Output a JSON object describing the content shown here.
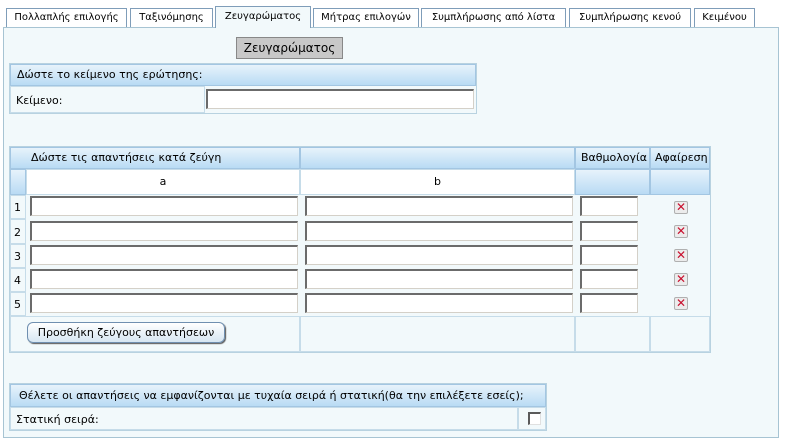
{
  "tabs": [
    {
      "label": "Πολλαπλής επιλογής"
    },
    {
      "label": "Ταξινόμησης"
    },
    {
      "label": "Ζευγαρώματος"
    },
    {
      "label": "Μήτρας επιλογών"
    },
    {
      "label": "Συμπλήρωσης από λίστα"
    },
    {
      "label": "Συμπλήρωσης κενού"
    },
    {
      "label": "Κειμένου"
    }
  ],
  "active_tab": "Ζευγαρώματος",
  "title_button": "Ζευγαρώματος",
  "question": {
    "header": "Δώστε το κείμενο της ερώτησης:",
    "label": "Κείμενο:",
    "value": ""
  },
  "pairs": {
    "header": "Δώστε τις απαντήσεις κατά ζεύγη",
    "col_a": "a",
    "col_b": "b",
    "col_score": "Βαθμολογία",
    "col_remove": "Αφαίρεση",
    "rows": [
      {
        "num": "1",
        "a": "",
        "b": "",
        "score": ""
      },
      {
        "num": "2",
        "a": "",
        "b": "",
        "score": ""
      },
      {
        "num": "3",
        "a": "",
        "b": "",
        "score": ""
      },
      {
        "num": "4",
        "a": "",
        "b": "",
        "score": ""
      },
      {
        "num": "5",
        "a": "",
        "b": "",
        "score": ""
      }
    ],
    "add_button": "Προσθήκη ζεύγους απαντήσεων",
    "remove_glyph": "✕"
  },
  "order": {
    "header": "Θέλετε οι απαντήσεις να εμφανίζονται με τυχαία σειρά ή στατική(θα την επιλέξετε εσείς);",
    "label": "Στατική σειρά:",
    "checked": false
  },
  "colors": {
    "accent": "#b9dbf4",
    "panel": "#f2f9fb",
    "remove_icon": "#c8102e"
  }
}
